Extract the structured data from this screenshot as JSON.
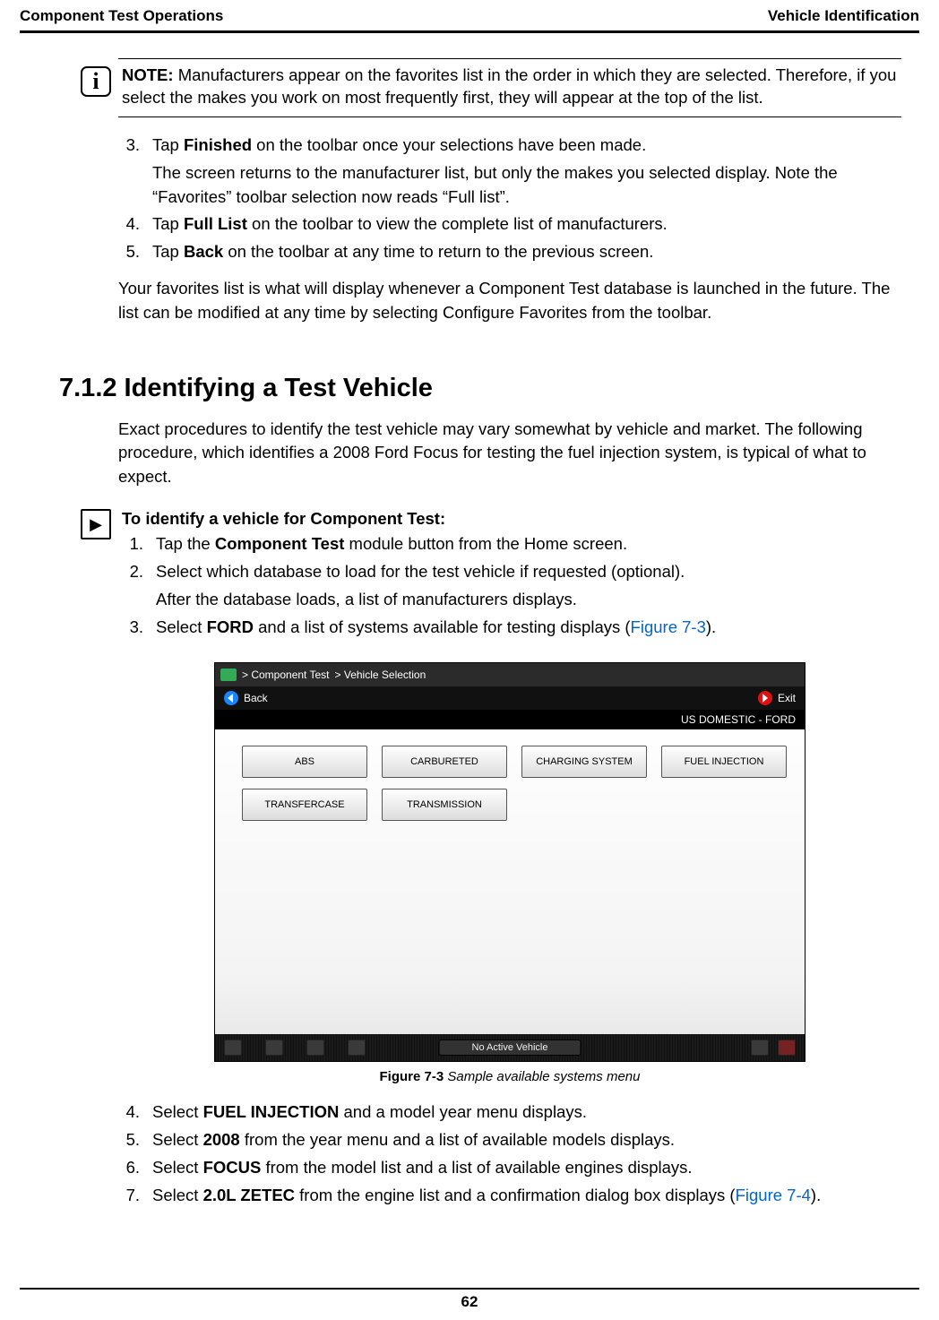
{
  "header": {
    "left": "Component Test Operations",
    "right": "Vehicle Identification"
  },
  "note": {
    "title": "NOTE:",
    "text": "Manufacturers appear on the favorites list in the order in which they are selected. Therefore, if you select the makes you work on most frequently first, they will appear at the top of the list."
  },
  "steps_a": {
    "s3_num": "3.",
    "s3_pre": "Tap ",
    "s3_bold": "Finished",
    "s3_post": " on the toolbar once your selections have been made.",
    "s3_sub": "The screen returns to the manufacturer list, but only the makes you selected display. Note the “Favorites” toolbar selection now reads “Full list”.",
    "s4_num": "4.",
    "s4_pre": "Tap ",
    "s4_bold": "Full List",
    "s4_post": " on the toolbar to view the complete list of manufacturers.",
    "s5_num": "5.",
    "s5_pre": "Tap ",
    "s5_bold": "Back",
    "s5_post": " on the toolbar at any time to return to the previous screen."
  },
  "para_a": "Your favorites list is what will display whenever a Component Test database is launched in the future. The list can be modified at any time by selecting Configure Favorites from the toolbar.",
  "section_heading": "7.1.2  Identifying a Test Vehicle",
  "para_b": "Exact procedures to identify the test vehicle may vary somewhat by vehicle and market. The following procedure, which identifies a 2008 Ford Focus for testing the fuel injection system, is typical of what to expect.",
  "proc_title": "To identify a vehicle for Component Test:",
  "steps_b": {
    "s1_num": "1.",
    "s1_pre": "Tap the ",
    "s1_bold": "Component Test",
    "s1_post": " module button from the Home screen.",
    "s2_num": "2.",
    "s2_text": "Select which database to load for the test vehicle if requested (optional).",
    "s2_sub": "After the database loads, a list of manufacturers displays.",
    "s3_num": "3.",
    "s3_pre": "Select ",
    "s3_bold": "FORD",
    "s3_post": " and a list of systems available for testing displays (",
    "s3_link": "Figure 7-3",
    "s3_end": ")."
  },
  "figure": {
    "breadcrumb_1": "> Component Test",
    "breadcrumb_2": "> Vehicle Selection",
    "back_label": "Back",
    "exit_label": "Exit",
    "context": "US DOMESTIC - FORD",
    "buttons": [
      "ABS",
      "CARBURETED",
      "CHARGING SYSTEM",
      "FUEL INJECTION",
      "TRANSFERCASE",
      "TRANSMISSION"
    ],
    "footer_center": "No Active Vehicle",
    "caption_bold": "Figure 7-3",
    "caption_italic": " Sample available systems menu"
  },
  "steps_c": {
    "s4_num": "4.",
    "s4_pre": "Select ",
    "s4_bold": "FUEL INJECTION",
    "s4_post": " and a model year menu displays.",
    "s5_num": "5.",
    "s5_pre": "Select ",
    "s5_bold": "2008",
    "s5_post": " from the year menu and a list of available models displays.",
    "s6_num": "6.",
    "s6_pre": "Select ",
    "s6_bold": "FOCUS",
    "s6_post": " from the model list and a list of available engines displays.",
    "s7_num": "7.",
    "s7_pre": "Select ",
    "s7_bold": "2.0L ZETEC",
    "s7_post": " from the engine list and a confirmation dialog box displays (",
    "s7_link": "Figure 7-4",
    "s7_end": ")."
  },
  "page_number": "62"
}
